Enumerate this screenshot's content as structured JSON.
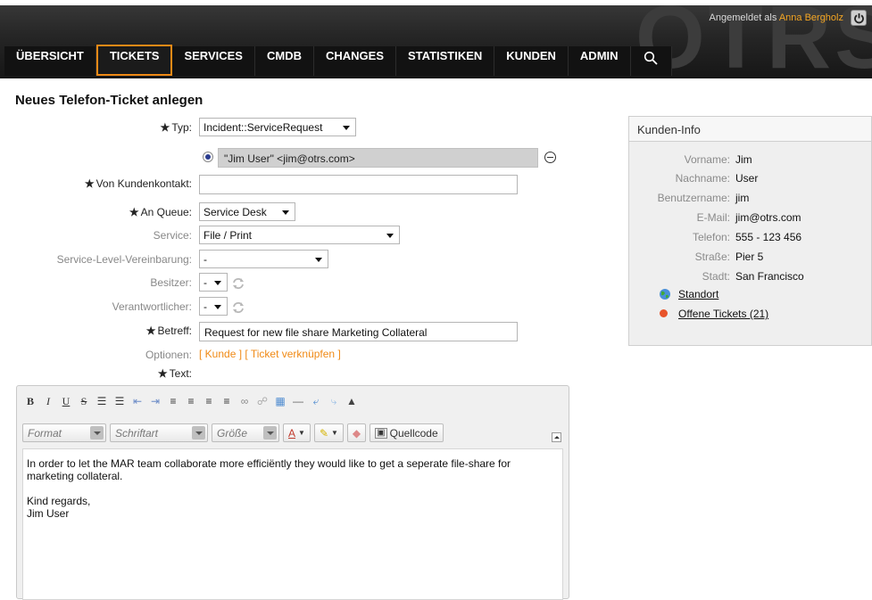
{
  "header": {
    "logo": "OTRS",
    "login_prefix": "Angemeldet als",
    "login_user": "Anna Bergholz",
    "nav": [
      {
        "label": "ÜBERSICHT"
      },
      {
        "label": "TICKETS"
      },
      {
        "label": "SERVICES"
      },
      {
        "label": "CMDB"
      },
      {
        "label": "CHANGES"
      },
      {
        "label": "STATISTIKEN"
      },
      {
        "label": "KUNDEN"
      },
      {
        "label": "ADMIN"
      }
    ],
    "active_nav": "TICKETS"
  },
  "page_title": "Neues Telefon-Ticket anlegen",
  "form": {
    "typ_label": "Typ:",
    "typ_value": "Incident::ServiceRequest",
    "customer_entry": "\"Jim User\" <jim@otrs.com>",
    "von_label": "Von Kundenkontakt:",
    "von_value": "",
    "queue_label": "An Queue:",
    "queue_value": "Service Desk",
    "service_label": "Service:",
    "service_value": "File / Print",
    "sla_label": "Service-Level-Vereinbarung:",
    "sla_value": "-",
    "owner_label": "Besitzer:",
    "owner_value": "-",
    "responsible_label": "Verantwortlicher:",
    "responsible_value": "-",
    "subject_label": "Betreff:",
    "subject_value": "Request for new file share Marketing Collateral",
    "options_label": "Optionen:",
    "options_link_customer": "[ Kunde ]",
    "options_link_ticket": "[ Ticket verknüpfen ]",
    "text_label": "Text:",
    "required_mark": "★"
  },
  "editor": {
    "format_label": "Format",
    "font_label": "Schriftart",
    "size_label": "Größe",
    "source_label": "Quellcode",
    "body_paragraph_1": "In order to let the MAR team collaborate more efficiëntly they would like to get a seperate file-share for marketing collateral.",
    "body_paragraph_2": "Kind regards,\nJim User",
    "toolbar_icons": [
      "bold-icon",
      "italic-icon",
      "underline-icon",
      "strikethrough-icon",
      "numbered-list-icon",
      "bulleted-list-icon",
      "outdent-icon",
      "indent-icon",
      "align-left-icon",
      "align-center-icon",
      "align-right-icon",
      "justify-icon",
      "link-icon",
      "unlink-icon",
      "image-icon",
      "horizontal-rule-icon",
      "undo-icon",
      "redo-icon",
      "find-icon"
    ]
  },
  "customer_info": {
    "title": "Kunden-Info",
    "fields": [
      {
        "key": "Vorname:",
        "value": "Jim"
      },
      {
        "key": "Nachname:",
        "value": "User"
      },
      {
        "key": "Benutzername:",
        "value": "jim"
      },
      {
        "key": "E-Mail:",
        "value": "jim@otrs.com"
      },
      {
        "key": "Telefon:",
        "value": "555 - 123 456"
      },
      {
        "key": "Straße:",
        "value": "Pier 5"
      },
      {
        "key": "Stadt:",
        "value": "San Francisco"
      }
    ],
    "location_link": "Standort",
    "open_tickets_link": "Offene Tickets (21)"
  },
  "colors": {
    "accent": "#f08a16",
    "header_dark": "#161616",
    "open_tickets_dot": "#e8532a",
    "globe_green": "#3fa93a"
  }
}
